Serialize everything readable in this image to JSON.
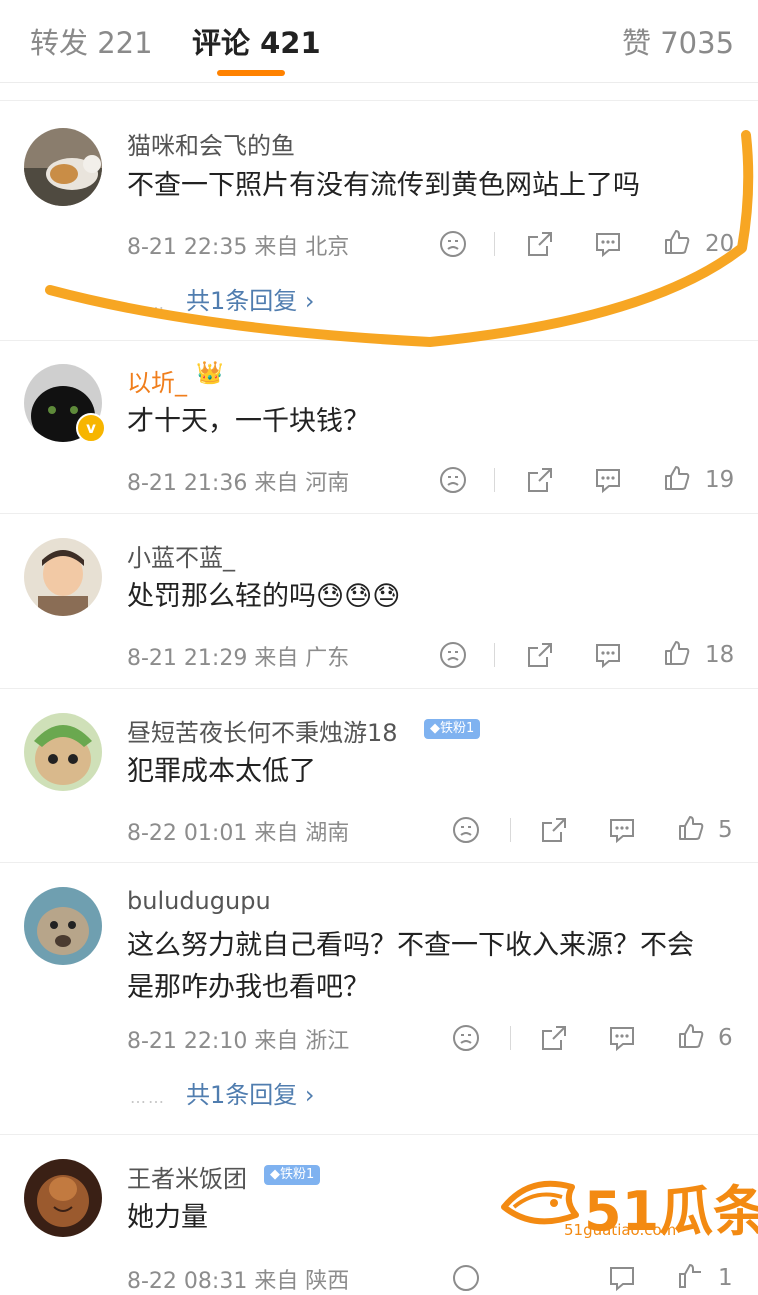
{
  "tabs": {
    "repost": "转发 221",
    "comments": "评论 421",
    "likes": "赞 7035"
  },
  "colors": {
    "accent": "#ff8200",
    "link": "#507daf",
    "meta": "#8c8c8c"
  },
  "comments": [
    {
      "username": "猫咪和会飞的鱼",
      "text": "不查一下照片有没有流传到黄色网站上了吗",
      "meta": "8-21 22:35  来自 北京",
      "likes": "20",
      "replies": "共1条回复 ›"
    },
    {
      "username": "以圻_",
      "crown": "👑",
      "verified": "v",
      "text": "才十天，一千块钱？",
      "meta": "8-21 21:36  来自 河南",
      "likes": "19"
    },
    {
      "username": "小蓝不蓝_",
      "text": "处罚那么轻的吗😓😓😓",
      "meta": "8-21 21:29  来自 广东",
      "likes": "18"
    },
    {
      "username": "昼短苦夜长何不秉烛游18",
      "badge": "◆铁粉1",
      "text": "犯罪成本太低了",
      "meta": "8-22 01:01  来自 湖南",
      "likes": "5"
    },
    {
      "username": "buludugupu",
      "text": "这么努力就自己看吗？不查一下收入来源？不会是那咋办我也看吧？",
      "meta": "8-21 22:10  来自 浙江",
      "likes": "6",
      "replies": "共1条回复 ›"
    },
    {
      "username": "王者米饭团",
      "badge": "◆铁粉1",
      "text": "她力量",
      "meta": "8-22 08:31  来自 陕西",
      "likes": "1"
    }
  ],
  "watermark": {
    "text": "51瓜条",
    "url": "51guatiao.com"
  }
}
